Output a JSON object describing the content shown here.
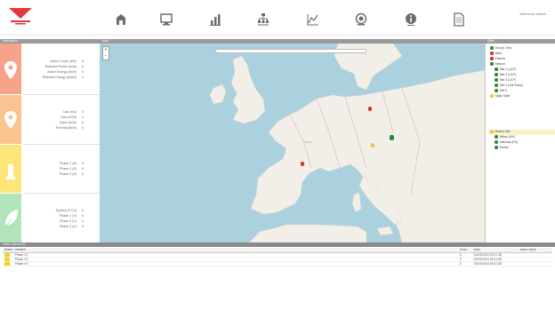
{
  "colors": {
    "brand_red": "#e03a3e",
    "sea": "#acd1de",
    "land": "#f2efe9",
    "strip_red": "#f7a38b",
    "strip_orange": "#fbc390",
    "strip_yellow": "#fde57a",
    "strip_green": "#b3e3b8",
    "marker_red": "#d9312d",
    "marker_green": "#2a8a3a",
    "marker_yellow": "#f2c23a",
    "alarm_yellow": "#f5d21a"
  },
  "toolbar": {
    "icons": [
      "home-icon",
      "monitor-icon",
      "bar-chart-icon",
      "hierarchy-icon",
      "trend-chart-icon",
      "support-icon",
      "info-icon",
      "document-icon"
    ],
    "user": "Welcome: admin"
  },
  "left_panel": {
    "header": "Information",
    "sections": [
      {
        "icon": "location-pin-icon",
        "rows": [
          {
            "label": "Active Power (kW)",
            "value": "0"
          },
          {
            "label": "Reactive Power (kvar)",
            "value": "0"
          },
          {
            "label": "Active Energy (kWh)",
            "value": "0"
          },
          {
            "label": "Reactive Energy (kvarh)",
            "value": "0"
          }
        ]
      },
      {
        "icon": "location-pin-icon",
        "rows": [
          {
            "label": "Gas (m3)",
            "value": "0"
          },
          {
            "label": "Gas (m3/h)",
            "value": "0"
          },
          {
            "label": "Solar (kWh)",
            "value": "0"
          },
          {
            "label": "Thermal (kWh)",
            "value": "0"
          }
        ]
      },
      {
        "icon": "level-icon",
        "rows": [
          {
            "label": "Phase 1 (A)",
            "value": "0"
          },
          {
            "label": "Phase 2 (A)",
            "value": "0"
          },
          {
            "label": "Phase 3 (A)",
            "value": "0"
          }
        ]
      },
      {
        "icon": "leaf-icon",
        "rows": [
          {
            "label": "System (V LN)",
            "value": "0"
          },
          {
            "label": "Phase 1 (V)",
            "value": "0"
          },
          {
            "label": "Phase 2 (V)",
            "value": "0"
          },
          {
            "label": "Phase 3 (V)",
            "value": "0"
          }
        ]
      }
    ]
  },
  "map": {
    "header": "Map",
    "zoom_in": "+",
    "zoom_out": "−",
    "search_placeholder": "",
    "markers": [
      {
        "color": "#d9312d"
      },
      {
        "color": "#2a8a3a"
      },
      {
        "color": "#f2c23a"
      },
      {
        "color": "#d9312d"
      }
    ]
  },
  "tree": {
    "header": "Sites",
    "items": [
      {
        "label": "Group1 Test",
        "color": "#2a8a3a",
        "indent": 1
      },
      {
        "label": "Italia",
        "color": "#d9312d",
        "indent": 1
      },
      {
        "label": "Padova",
        "color": "#d9312d",
        "indent": 1
      },
      {
        "label": "Belluno",
        "color": "#2a8a3a",
        "indent": 1
      },
      {
        "label": "Site 1 (ULP)",
        "color": "#2a8a3a",
        "indent": 2
      },
      {
        "label": "Site 2 (ULP)",
        "color": "#2a8a3a",
        "indent": 2
      },
      {
        "label": "Site 3 (ULP)",
        "color": "#2a8a3a",
        "indent": 2
      },
      {
        "label": "Site 4 (VM Pulse)",
        "color": "#2a8a3a",
        "indent": 2
      },
      {
        "label": "Site 5",
        "color": "#2a8a3a",
        "indent": 2
      },
      {
        "label": "Spain Main",
        "color": "#f2c23a",
        "indent": 1
      },
      {
        "label": "Madrid Site",
        "color": "#f2c23a",
        "indent": 1
      },
      {
        "label": "Bilbao (UK)",
        "color": "#2a8a3a",
        "indent": 2
      },
      {
        "label": "Valencia (ES)",
        "color": "#2a8a3a",
        "indent": 2
      },
      {
        "label": "Sevilla",
        "color": "#2a8a3a",
        "indent": 2
      }
    ]
  },
  "alarms": {
    "header": "Active Alarms (3)",
    "columns": [
      "Status",
      "Variable",
      "Level",
      "Date",
      "Alarm Value"
    ],
    "rows": [
      {
        "variable": "Phase V1",
        "level": "3",
        "date": "01/03/2016 15:01:38",
        "value": ""
      },
      {
        "variable": "Phase V2",
        "level": "3",
        "date": "01/03/2016 15:01:38",
        "value": ""
      },
      {
        "variable": "Phase V3",
        "level": "3",
        "date": "01/03/2016 15:01:38",
        "value": ""
      }
    ]
  }
}
